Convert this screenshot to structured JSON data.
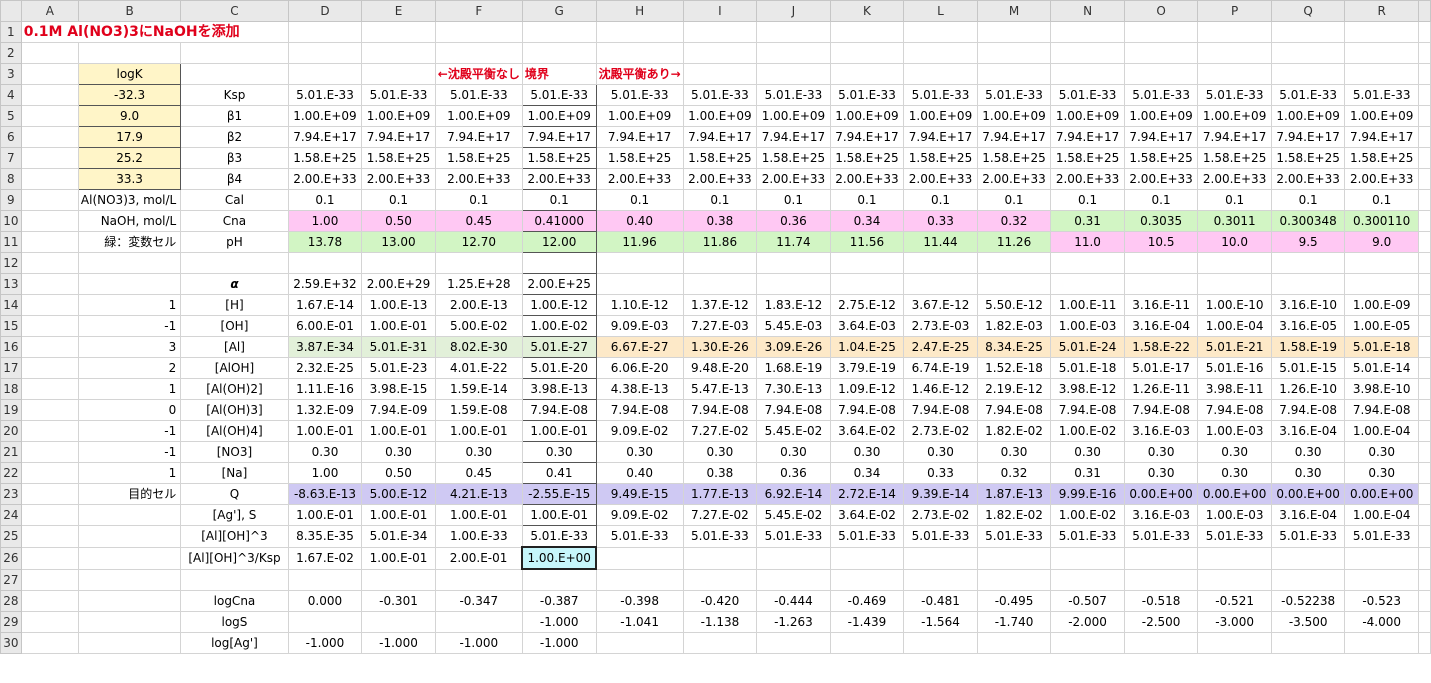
{
  "title": "0.1M Al(NO3)3にNaOHを添加",
  "columns": [
    "A",
    "B",
    "C",
    "D",
    "E",
    "F",
    "G",
    "H",
    "I",
    "J",
    "K",
    "L",
    "M",
    "N",
    "O",
    "P",
    "Q",
    "R"
  ],
  "annotations": {
    "no_precip": "←沈殿平衡なし",
    "boundary": "境界",
    "precip": "沈殿平衡あり→"
  },
  "rows": [
    {
      "r": "1",
      "cells": {}
    },
    {
      "r": "2",
      "cells": {}
    },
    {
      "r": "3",
      "cells": {
        "B": "logK"
      }
    },
    {
      "r": "4",
      "cells": {
        "B": "-32.3",
        "C": "Ksp",
        "D": "5.01.E-33",
        "E": "5.01.E-33",
        "F": "5.01.E-33",
        "G": "5.01.E-33",
        "H": "5.01.E-33",
        "I": "5.01.E-33",
        "J": "5.01.E-33",
        "K": "5.01.E-33",
        "L": "5.01.E-33",
        "M": "5.01.E-33",
        "N": "5.01.E-33",
        "O": "5.01.E-33",
        "P": "5.01.E-33",
        "Q": "5.01.E-33",
        "R": "5.01.E-33"
      }
    },
    {
      "r": "5",
      "cells": {
        "B": "9.0",
        "C": "β1",
        "D": "1.00.E+09",
        "E": "1.00.E+09",
        "F": "1.00.E+09",
        "G": "1.00.E+09",
        "H": "1.00.E+09",
        "I": "1.00.E+09",
        "J": "1.00.E+09",
        "K": "1.00.E+09",
        "L": "1.00.E+09",
        "M": "1.00.E+09",
        "N": "1.00.E+09",
        "O": "1.00.E+09",
        "P": "1.00.E+09",
        "Q": "1.00.E+09",
        "R": "1.00.E+09"
      }
    },
    {
      "r": "6",
      "cells": {
        "B": "17.9",
        "C": "β2",
        "D": "7.94.E+17",
        "E": "7.94.E+17",
        "F": "7.94.E+17",
        "G": "7.94.E+17",
        "H": "7.94.E+17",
        "I": "7.94.E+17",
        "J": "7.94.E+17",
        "K": "7.94.E+17",
        "L": "7.94.E+17",
        "M": "7.94.E+17",
        "N": "7.94.E+17",
        "O": "7.94.E+17",
        "P": "7.94.E+17",
        "Q": "7.94.E+17",
        "R": "7.94.E+17"
      }
    },
    {
      "r": "7",
      "cells": {
        "B": "25.2",
        "C": "β3",
        "D": "1.58.E+25",
        "E": "1.58.E+25",
        "F": "1.58.E+25",
        "G": "1.58.E+25",
        "H": "1.58.E+25",
        "I": "1.58.E+25",
        "J": "1.58.E+25",
        "K": "1.58.E+25",
        "L": "1.58.E+25",
        "M": "1.58.E+25",
        "N": "1.58.E+25",
        "O": "1.58.E+25",
        "P": "1.58.E+25",
        "Q": "1.58.E+25",
        "R": "1.58.E+25"
      }
    },
    {
      "r": "8",
      "cells": {
        "B": "33.3",
        "C": "β4",
        "D": "2.00.E+33",
        "E": "2.00.E+33",
        "F": "2.00.E+33",
        "G": "2.00.E+33",
        "H": "2.00.E+33",
        "I": "2.00.E+33",
        "J": "2.00.E+33",
        "K": "2.00.E+33",
        "L": "2.00.E+33",
        "M": "2.00.E+33",
        "N": "2.00.E+33",
        "O": "2.00.E+33",
        "P": "2.00.E+33",
        "Q": "2.00.E+33",
        "R": "2.00.E+33"
      }
    },
    {
      "r": "9",
      "cells": {
        "B": "Al(NO3)3, mol/L",
        "C": "Cal",
        "D": "0.1",
        "E": "0.1",
        "F": "0.1",
        "G": "0.1",
        "H": "0.1",
        "I": "0.1",
        "J": "0.1",
        "K": "0.1",
        "L": "0.1",
        "M": "0.1",
        "N": "0.1",
        "O": "0.1",
        "P": "0.1",
        "Q": "0.1",
        "R": "0.1"
      }
    },
    {
      "r": "10",
      "cells": {
        "B": "NaOH, mol/L",
        "C": "Cna",
        "D": "1.00",
        "E": "0.50",
        "F": "0.45",
        "G": "0.41000",
        "H": "0.40",
        "I": "0.38",
        "J": "0.36",
        "K": "0.34",
        "L": "0.33",
        "M": "0.32",
        "N": "0.31",
        "O": "0.3035",
        "P": "0.3011",
        "Q": "0.300348",
        "R": "0.300110"
      }
    },
    {
      "r": "11",
      "cells": {
        "B": "緑：変数セル",
        "C": "pH",
        "D": "13.78",
        "E": "13.00",
        "F": "12.70",
        "G": "12.00",
        "H": "11.96",
        "I": "11.86",
        "J": "11.74",
        "K": "11.56",
        "L": "11.44",
        "M": "11.26",
        "N": "11.0",
        "O": "10.5",
        "P": "10.0",
        "Q": "9.5",
        "R": "9.0"
      }
    },
    {
      "r": "12",
      "cells": {}
    },
    {
      "r": "13",
      "cells": {
        "C": "α",
        "D": "2.59.E+32",
        "E": "2.00.E+29",
        "F": "1.25.E+28",
        "G": "2.00.E+25"
      }
    },
    {
      "r": "14",
      "cells": {
        "B": "1",
        "C": "[H]",
        "D": "1.67.E-14",
        "E": "1.00.E-13",
        "F": "2.00.E-13",
        "G": "1.00.E-12",
        "H": "1.10.E-12",
        "I": "1.37.E-12",
        "J": "1.83.E-12",
        "K": "2.75.E-12",
        "L": "3.67.E-12",
        "M": "5.50.E-12",
        "N": "1.00.E-11",
        "O": "3.16.E-11",
        "P": "1.00.E-10",
        "Q": "3.16.E-10",
        "R": "1.00.E-09"
      }
    },
    {
      "r": "15",
      "cells": {
        "B": "-1",
        "C": "[OH]",
        "D": "6.00.E-01",
        "E": "1.00.E-01",
        "F": "5.00.E-02",
        "G": "1.00.E-02",
        "H": "9.09.E-03",
        "I": "7.27.E-03",
        "J": "5.45.E-03",
        "K": "3.64.E-03",
        "L": "2.73.E-03",
        "M": "1.82.E-03",
        "N": "1.00.E-03",
        "O": "3.16.E-04",
        "P": "1.00.E-04",
        "Q": "3.16.E-05",
        "R": "1.00.E-05"
      }
    },
    {
      "r": "16",
      "cells": {
        "B": "3",
        "C": "[Al]",
        "D": "3.87.E-34",
        "E": "5.01.E-31",
        "F": "8.02.E-30",
        "G": "5.01.E-27",
        "H": "6.67.E-27",
        "I": "1.30.E-26",
        "J": "3.09.E-26",
        "K": "1.04.E-25",
        "L": "2.47.E-25",
        "M": "8.34.E-25",
        "N": "5.01.E-24",
        "O": "1.58.E-22",
        "P": "5.01.E-21",
        "Q": "1.58.E-19",
        "R": "5.01.E-18"
      }
    },
    {
      "r": "17",
      "cells": {
        "B": "2",
        "C": "[AlOH]",
        "D": "2.32.E-25",
        "E": "5.01.E-23",
        "F": "4.01.E-22",
        "G": "5.01.E-20",
        "H": "6.06.E-20",
        "I": "9.48.E-20",
        "J": "1.68.E-19",
        "K": "3.79.E-19",
        "L": "6.74.E-19",
        "M": "1.52.E-18",
        "N": "5.01.E-18",
        "O": "5.01.E-17",
        "P": "5.01.E-16",
        "Q": "5.01.E-15",
        "R": "5.01.E-14"
      }
    },
    {
      "r": "18",
      "cells": {
        "B": "1",
        "C": "[Al(OH)2]",
        "D": "1.11.E-16",
        "E": "3.98.E-15",
        "F": "1.59.E-14",
        "G": "3.98.E-13",
        "H": "4.38.E-13",
        "I": "5.47.E-13",
        "J": "7.30.E-13",
        "K": "1.09.E-12",
        "L": "1.46.E-12",
        "M": "2.19.E-12",
        "N": "3.98.E-12",
        "O": "1.26.E-11",
        "P": "3.98.E-11",
        "Q": "1.26.E-10",
        "R": "3.98.E-10"
      }
    },
    {
      "r": "19",
      "cells": {
        "B": "0",
        "C": "[Al(OH)3]",
        "D": "1.32.E-09",
        "E": "7.94.E-09",
        "F": "1.59.E-08",
        "G": "7.94.E-08",
        "H": "7.94.E-08",
        "I": "7.94.E-08",
        "J": "7.94.E-08",
        "K": "7.94.E-08",
        "L": "7.94.E-08",
        "M": "7.94.E-08",
        "N": "7.94.E-08",
        "O": "7.94.E-08",
        "P": "7.94.E-08",
        "Q": "7.94.E-08",
        "R": "7.94.E-08"
      }
    },
    {
      "r": "20",
      "cells": {
        "B": "-1",
        "C": "[Al(OH)4]",
        "D": "1.00.E-01",
        "E": "1.00.E-01",
        "F": "1.00.E-01",
        "G": "1.00.E-01",
        "H": "9.09.E-02",
        "I": "7.27.E-02",
        "J": "5.45.E-02",
        "K": "3.64.E-02",
        "L": "2.73.E-02",
        "M": "1.82.E-02",
        "N": "1.00.E-02",
        "O": "3.16.E-03",
        "P": "1.00.E-03",
        "Q": "3.16.E-04",
        "R": "1.00.E-04"
      }
    },
    {
      "r": "21",
      "cells": {
        "B": "-1",
        "C": "[NO3]",
        "D": "0.30",
        "E": "0.30",
        "F": "0.30",
        "G": "0.30",
        "H": "0.30",
        "I": "0.30",
        "J": "0.30",
        "K": "0.30",
        "L": "0.30",
        "M": "0.30",
        "N": "0.30",
        "O": "0.30",
        "P": "0.30",
        "Q": "0.30",
        "R": "0.30"
      }
    },
    {
      "r": "22",
      "cells": {
        "B": "1",
        "C": "[Na]",
        "D": "1.00",
        "E": "0.50",
        "F": "0.45",
        "G": "0.41",
        "H": "0.40",
        "I": "0.38",
        "J": "0.36",
        "K": "0.34",
        "L": "0.33",
        "M": "0.32",
        "N": "0.31",
        "O": "0.30",
        "P": "0.30",
        "Q": "0.30",
        "R": "0.30"
      }
    },
    {
      "r": "23",
      "cells": {
        "B": "目的セル",
        "C": "Q",
        "D": "-8.63.E-13",
        "E": "5.00.E-12",
        "F": "4.21.E-13",
        "G": "-2.55.E-15",
        "H": "9.49.E-15",
        "I": "1.77.E-13",
        "J": "6.92.E-14",
        "K": "2.72.E-14",
        "L": "9.39.E-14",
        "M": "1.87.E-13",
        "N": "9.99.E-16",
        "O": "0.00.E+00",
        "P": "0.00.E+00",
        "Q": "0.00.E+00",
        "R": "0.00.E+00"
      }
    },
    {
      "r": "24",
      "cells": {
        "C": "[Ag'], S",
        "D": "1.00.E-01",
        "E": "1.00.E-01",
        "F": "1.00.E-01",
        "G": "1.00.E-01",
        "H": "9.09.E-02",
        "I": "7.27.E-02",
        "J": "5.45.E-02",
        "K": "3.64.E-02",
        "L": "2.73.E-02",
        "M": "1.82.E-02",
        "N": "1.00.E-02",
        "O": "3.16.E-03",
        "P": "1.00.E-03",
        "Q": "3.16.E-04",
        "R": "1.00.E-04"
      }
    },
    {
      "r": "25",
      "cells": {
        "C": "[Al][OH]^3",
        "D": "8.35.E-35",
        "E": "5.01.E-34",
        "F": "1.00.E-33",
        "G": "5.01.E-33",
        "H": "5.01.E-33",
        "I": "5.01.E-33",
        "J": "5.01.E-33",
        "K": "5.01.E-33",
        "L": "5.01.E-33",
        "M": "5.01.E-33",
        "N": "5.01.E-33",
        "O": "5.01.E-33",
        "P": "5.01.E-33",
        "Q": "5.01.E-33",
        "R": "5.01.E-33"
      }
    },
    {
      "r": "26",
      "cells": {
        "C": "[Al][OH]^3/Ksp",
        "D": "1.67.E-02",
        "E": "1.00.E-01",
        "F": "2.00.E-01",
        "G": "1.00.E+00"
      }
    },
    {
      "r": "27",
      "cells": {}
    },
    {
      "r": "28",
      "cells": {
        "C": "logCna",
        "D": "0.000",
        "E": "-0.301",
        "F": "-0.347",
        "G": "-0.387",
        "H": "-0.398",
        "I": "-0.420",
        "J": "-0.444",
        "K": "-0.469",
        "L": "-0.481",
        "M": "-0.495",
        "N": "-0.507",
        "O": "-0.518",
        "P": "-0.521",
        "Q": "-0.52238",
        "R": "-0.523"
      }
    },
    {
      "r": "29",
      "cells": {
        "C": "logS",
        "G": "-1.000",
        "H": "-1.041",
        "I": "-1.138",
        "J": "-1.263",
        "K": "-1.439",
        "L": "-1.564",
        "M": "-1.740",
        "N": "-2.000",
        "O": "-2.500",
        "P": "-3.000",
        "Q": "-3.500",
        "R": "-4.000"
      }
    },
    {
      "r": "30",
      "cells": {
        "C": "log[Ag']",
        "D": "-1.000",
        "E": "-1.000",
        "F": "-1.000",
        "G": "-1.000"
      }
    }
  ],
  "colors": {
    "title_red": "#e0001b",
    "yellow_input": "#fff5c8",
    "pink": "#ffc8f3",
    "green": "#d2f5c4",
    "orange": "#fde9c8",
    "blue_purple": "#cfc9f3",
    "cyan": "#c6f6fb",
    "header_gray": "#e9e9e9"
  }
}
